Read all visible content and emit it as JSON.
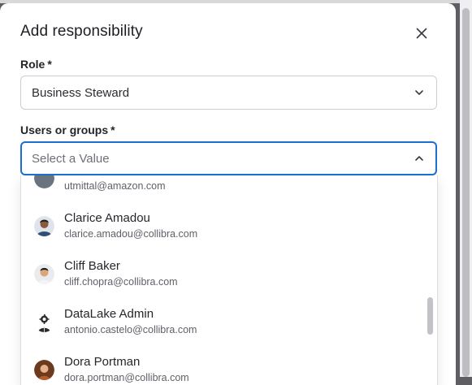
{
  "dialog": {
    "title": "Add responsibility",
    "close_icon": "close-icon"
  },
  "role": {
    "label": "Role",
    "required_mark": "*",
    "value": "Business Steward",
    "icon": "chevron-down-icon"
  },
  "users": {
    "label": "Users or groups",
    "required_mark": "*",
    "placeholder": "Select a Value",
    "icon": "chevron-up-icon"
  },
  "options": [
    {
      "name": "",
      "email": "utmittal@amazon.com",
      "avatar": "user-avatar"
    },
    {
      "name": "Clarice Amadou",
      "email": "clarice.amadou@collibra.com",
      "avatar": "user-avatar"
    },
    {
      "name": "Cliff Baker",
      "email": "cliff.chopra@collibra.com",
      "avatar": "user-avatar"
    },
    {
      "name": "DataLake Admin",
      "email": "antonio.castelo@collibra.com",
      "avatar": "admin-avatar"
    },
    {
      "name": "Dora Portman",
      "email": "dora.portman@collibra.com",
      "avatar": "user-avatar"
    }
  ],
  "colors": {
    "focus_border": "#1c6fd1",
    "text": "#24252a",
    "muted": "#5f6169"
  }
}
